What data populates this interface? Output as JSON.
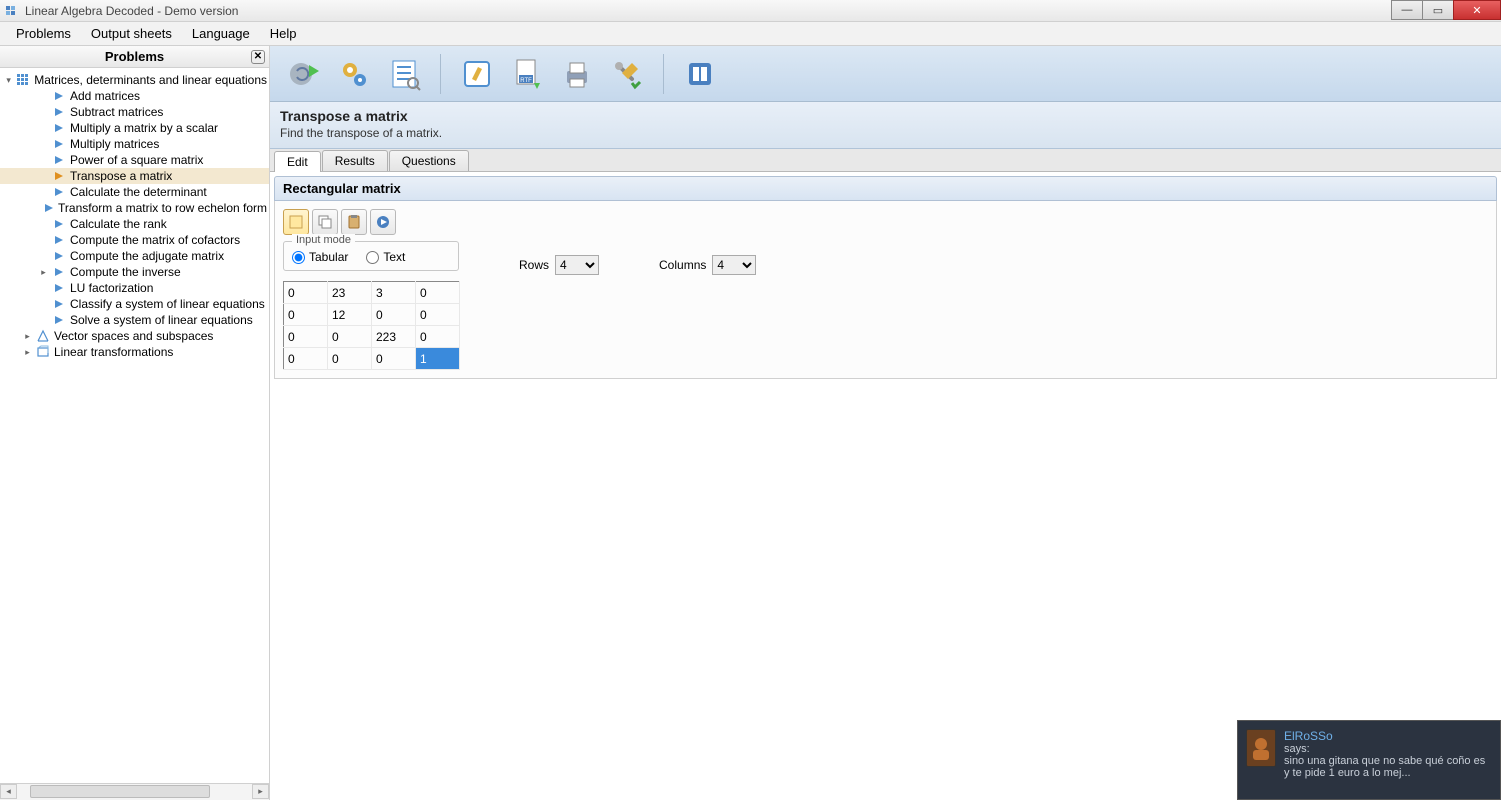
{
  "window_title": "Linear Algebra Decoded - Demo version",
  "menu": [
    "Problems",
    "Output sheets",
    "Language",
    "Help"
  ],
  "sidebar": {
    "title": "Problems",
    "root": "Matrices, determinants and linear equations",
    "items": [
      "Add matrices",
      "Subtract matrices",
      "Multiply a matrix by a scalar",
      "Multiply matrices",
      "Power of a square matrix",
      "Transpose a matrix",
      "Calculate the determinant",
      "Transform a matrix to row echelon form",
      "Calculate the rank",
      "Compute the matrix of cofactors",
      "Compute the adjugate matrix",
      "Compute the inverse",
      "LU factorization",
      "Classify a system of linear equations",
      "Solve a system of linear equations"
    ],
    "other_roots": [
      "Vector spaces and subspaces",
      "Linear transformations"
    ]
  },
  "operation": {
    "title": "Transpose a matrix",
    "desc": "Find the transpose of a matrix."
  },
  "tabs": [
    "Edit",
    "Results",
    "Questions"
  ],
  "group_header": "Rectangular matrix",
  "input_mode": {
    "legend": "Input mode",
    "tabular": "Tabular",
    "text": "Text"
  },
  "rows_label": "Rows",
  "cols_label": "Columns",
  "rows_value": "4",
  "cols_value": "4",
  "matrix": [
    [
      "0",
      "23",
      "3",
      "0"
    ],
    [
      "0",
      "12",
      "0",
      "0"
    ],
    [
      "0",
      "0",
      "223",
      "0"
    ],
    [
      "0",
      "0",
      "0",
      "1"
    ]
  ],
  "notif": {
    "name": "ElRoSSo",
    "says": "says:",
    "msg": "sino una gitana que no sabe qué coño es y te pide 1 euro a lo mej..."
  }
}
